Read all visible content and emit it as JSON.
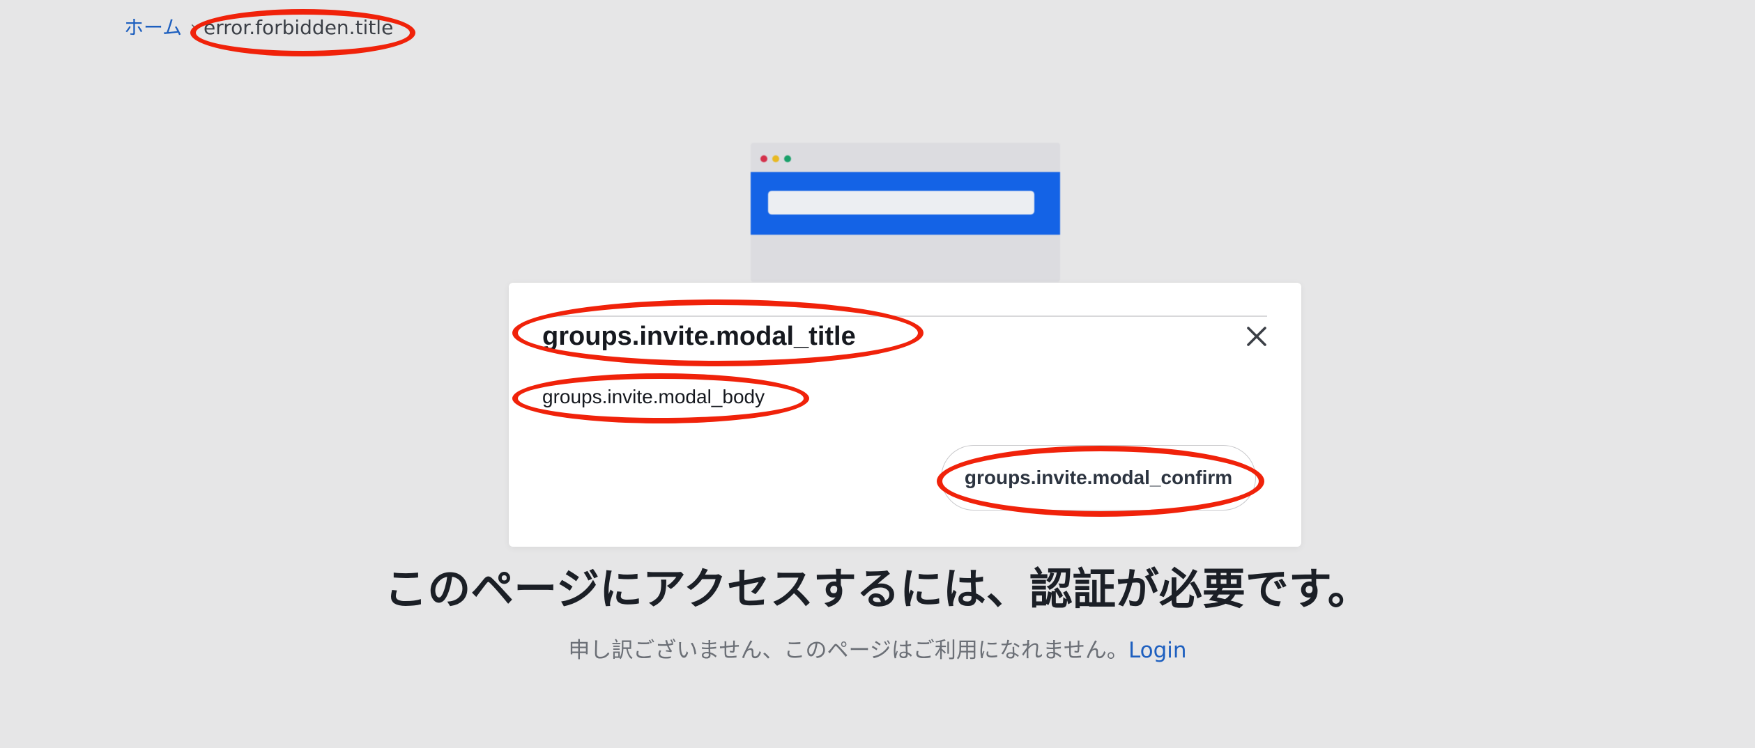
{
  "breadcrumb": {
    "home_label": "ホーム",
    "separator": "›",
    "current_label": "error.forbidden.title"
  },
  "illustration": {
    "window_dots": [
      "#d4314b",
      "#e8b923",
      "#19a06a"
    ],
    "accent_color": "#1463e6"
  },
  "modal": {
    "title": "groups.invite.modal_title",
    "body": "groups.invite.modal_body",
    "confirm_label": "groups.invite.modal_confirm",
    "close_icon": "close-icon"
  },
  "error": {
    "heading": "このページにアクセスするには、認証が必要です。",
    "message": "申し訳ございません、このページはご利用になれません。",
    "login_link": "Login"
  },
  "annotation_color": "#f0220a"
}
